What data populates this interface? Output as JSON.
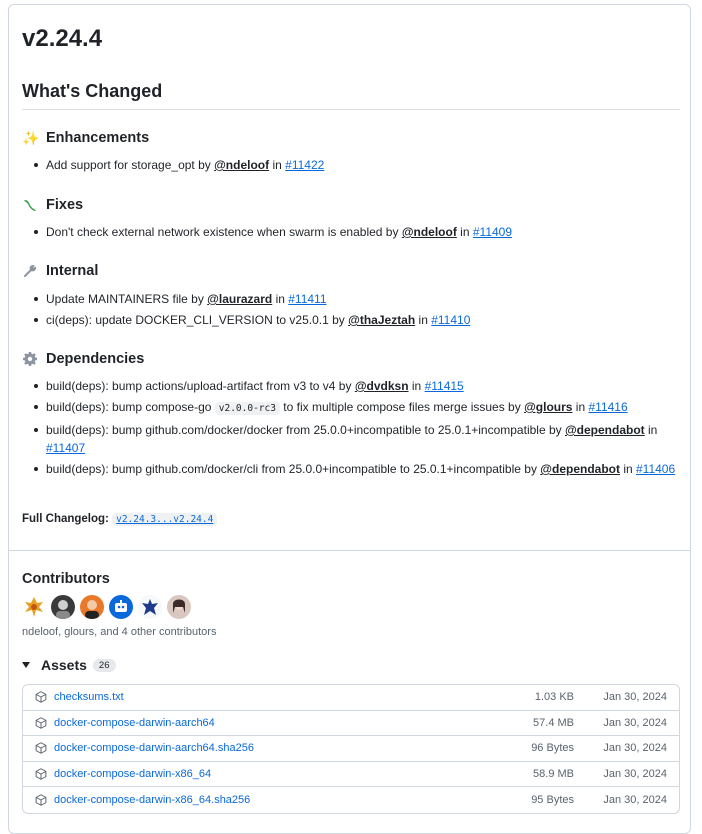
{
  "release": {
    "version": "v2.24.4",
    "whats_changed": "What's Changed"
  },
  "sections": [
    {
      "icon": "sparkles-icon",
      "glyph": "✨",
      "title": "Enhancements",
      "items": [
        {
          "text": "Add support for storage_opt by ",
          "mention": "@ndeloof",
          "in": " in ",
          "issue": "#11422"
        }
      ]
    },
    {
      "icon": "bug-icon",
      "glyph": "🐛",
      "title": "Fixes",
      "items": [
        {
          "text": "Don't check external network existence when swarm is enabled by ",
          "mention": "@ndeloof",
          "in": " in ",
          "issue": "#11409"
        }
      ]
    },
    {
      "icon": "wrench-icon",
      "glyph": "🔧",
      "title": "Internal",
      "items": [
        {
          "text": "Update MAINTAINERS file by ",
          "mention": "@laurazard",
          "in": " in ",
          "issue": "#11411"
        },
        {
          "text": "ci(deps): update DOCKER_CLI_VERSION to v25.0.1 by ",
          "mention": "@thaJeztah",
          "in": " in ",
          "issue": "#11410"
        }
      ]
    },
    {
      "icon": "gear-icon",
      "glyph": "⚙",
      "title": "Dependencies",
      "items": [
        {
          "text": "build(deps): bump actions/upload-artifact from v3 to v4 by ",
          "mention": "@dvdksn",
          "in": " in ",
          "issue": "#11415"
        },
        {
          "text": "build(deps): bump compose-go ",
          "code": "v2.0.0-rc3",
          "text2": " to fix multiple compose files merge issues by ",
          "mention": "@glours",
          "in": " in ",
          "issue": "#11416"
        },
        {
          "text": "build(deps): bump github.com/docker/docker from 25.0.0+incompatible to 25.0.1+incompatible by ",
          "mention": "@dependabot",
          "in": " in ",
          "issue": "#11407"
        },
        {
          "text": "build(deps): bump github.com/docker/cli from 25.0.0+incompatible to 25.0.1+incompatible by ",
          "mention": "@dependabot",
          "in": " in ",
          "issue": "#11406"
        }
      ]
    }
  ],
  "changelog": {
    "label": "Full Changelog:",
    "range": "v2.24.3...v2.24.4"
  },
  "contributors": {
    "title": "Contributors",
    "summary": "ndeloof, glours, and 4 other contributors",
    "avatars": [
      "ndeloof",
      "glours",
      "laurazard",
      "dependabot",
      "thaJeztah",
      "dvdksn"
    ]
  },
  "assets": {
    "title": "Assets",
    "count": "26",
    "rows": [
      {
        "name": "checksums.txt",
        "size": "1.03 KB",
        "date": "Jan 30, 2024"
      },
      {
        "name": "docker-compose-darwin-aarch64",
        "size": "57.4 MB",
        "date": "Jan 30, 2024"
      },
      {
        "name": "docker-compose-darwin-aarch64.sha256",
        "size": "96 Bytes",
        "date": "Jan 30, 2024"
      },
      {
        "name": "docker-compose-darwin-x86_64",
        "size": "58.9 MB",
        "date": "Jan 30, 2024"
      },
      {
        "name": "docker-compose-darwin-x86_64.sha256",
        "size": "95 Bytes",
        "date": "Jan 30, 2024"
      }
    ]
  }
}
